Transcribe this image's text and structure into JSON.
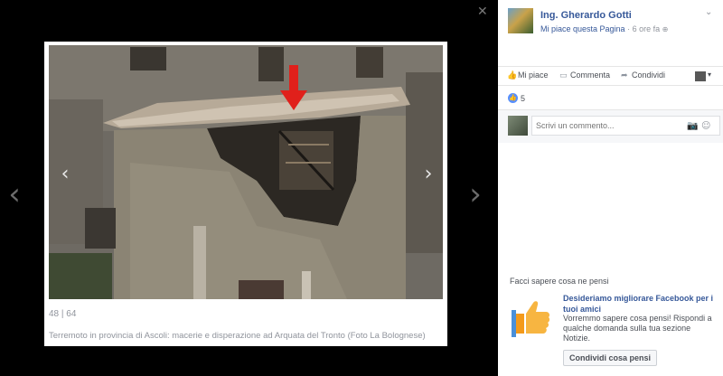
{
  "viewer": {
    "counter": "48 | 64",
    "caption": "Terremoto in provincia di Ascoli: macerie e disperazione ad Arquata del Tronto (Foto La Bolognese)",
    "prev_icon": "chevron-left-icon",
    "next_icon": "chevron-right-icon"
  },
  "post": {
    "author": "Ing. Gherardo Gotti",
    "like_page": "Mi piace questa Pagina",
    "separator": " · ",
    "time": "6 ore fa",
    "privacy_icon": "globe-icon"
  },
  "actions": {
    "like": "Mi piace",
    "comment": "Commenta",
    "share": "Condividi"
  },
  "reactions": {
    "count": "5"
  },
  "comment": {
    "placeholder": "Scrivi un commento..."
  },
  "feedback": {
    "title": "Facci sapere cosa ne pensi",
    "heading": "Desideriamo migliorare Facebook per i tuoi amici",
    "body": "Vorremmo sapere cosa pensi! Rispondi a qualche domanda sulla tua sezione Notizie.",
    "button": "Condividi cosa pensi"
  },
  "colors": {
    "link": "#365899",
    "muted": "#90949c",
    "annotation_arrow": "#e0201b"
  }
}
